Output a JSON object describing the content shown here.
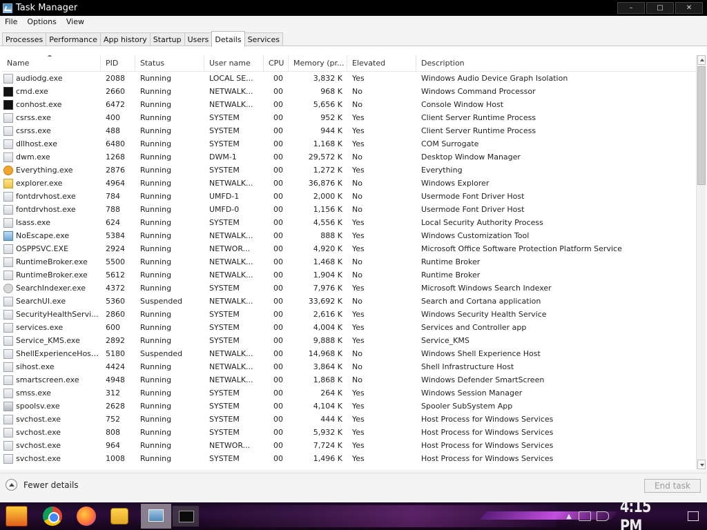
{
  "window": {
    "title": "Task Manager",
    "controls": [
      "–",
      "□",
      "✕"
    ]
  },
  "menu": [
    "File",
    "Options",
    "View"
  ],
  "tabs": [
    {
      "label": "Processes",
      "active": false
    },
    {
      "label": "Performance",
      "active": false
    },
    {
      "label": "App history",
      "active": false
    },
    {
      "label": "Startup",
      "active": false
    },
    {
      "label": "Users",
      "active": false
    },
    {
      "label": "Details",
      "active": true
    },
    {
      "label": "Services",
      "active": false
    }
  ],
  "columns": [
    "Name",
    "PID",
    "Status",
    "User name",
    "CPU",
    "Memory (pr...",
    "Elevated",
    "Description"
  ],
  "sort_column": "Name",
  "rows": [
    {
      "icon": "audio-icon",
      "name": "audiodg.exe",
      "pid": "2088",
      "status": "Running",
      "user": "LOCAL SE...",
      "cpu": "00",
      "mem": "3,832 K",
      "elevated": "Yes",
      "desc": "Windows Audio Device Graph Isolation"
    },
    {
      "icon": "cmd-icon",
      "name": "cmd.exe",
      "pid": "2660",
      "status": "Running",
      "user": "NETWALK...",
      "cpu": "00",
      "mem": "968 K",
      "elevated": "No",
      "desc": "Windows Command Processor"
    },
    {
      "icon": "cmd-icon",
      "name": "conhost.exe",
      "pid": "6472",
      "status": "Running",
      "user": "NETWALK...",
      "cpu": "00",
      "mem": "5,656 K",
      "elevated": "No",
      "desc": "Console Window Host"
    },
    {
      "icon": "process-icon",
      "name": "csrss.exe",
      "pid": "400",
      "status": "Running",
      "user": "SYSTEM",
      "cpu": "00",
      "mem": "952 K",
      "elevated": "Yes",
      "desc": "Client Server Runtime Process"
    },
    {
      "icon": "process-icon",
      "name": "csrss.exe",
      "pid": "488",
      "status": "Running",
      "user": "SYSTEM",
      "cpu": "00",
      "mem": "944 K",
      "elevated": "Yes",
      "desc": "Client Server Runtime Process"
    },
    {
      "icon": "process-icon",
      "name": "dllhost.exe",
      "pid": "6480",
      "status": "Running",
      "user": "SYSTEM",
      "cpu": "00",
      "mem": "1,168 K",
      "elevated": "Yes",
      "desc": "COM Surrogate"
    },
    {
      "icon": "process-icon",
      "name": "dwm.exe",
      "pid": "1268",
      "status": "Running",
      "user": "DWM-1",
      "cpu": "00",
      "mem": "29,572 K",
      "elevated": "No",
      "desc": "Desktop Window Manager"
    },
    {
      "icon": "search-icon",
      "name": "Everything.exe",
      "pid": "2876",
      "status": "Running",
      "user": "SYSTEM",
      "cpu": "00",
      "mem": "1,272 K",
      "elevated": "Yes",
      "desc": "Everything"
    },
    {
      "icon": "folder-icon",
      "name": "explorer.exe",
      "pid": "4964",
      "status": "Running",
      "user": "NETWALK...",
      "cpu": "00",
      "mem": "36,876 K",
      "elevated": "No",
      "desc": "Windows Explorer"
    },
    {
      "icon": "process-icon",
      "name": "fontdrvhost.exe",
      "pid": "784",
      "status": "Running",
      "user": "UMFD-1",
      "cpu": "00",
      "mem": "2,000 K",
      "elevated": "No",
      "desc": "Usermode Font Driver Host"
    },
    {
      "icon": "process-icon",
      "name": "fontdrvhost.exe",
      "pid": "788",
      "status": "Running",
      "user": "UMFD-0",
      "cpu": "00",
      "mem": "1,156 K",
      "elevated": "No",
      "desc": "Usermode Font Driver Host"
    },
    {
      "icon": "process-icon",
      "name": "lsass.exe",
      "pid": "624",
      "status": "Running",
      "user": "SYSTEM",
      "cpu": "00",
      "mem": "4,556 K",
      "elevated": "Yes",
      "desc": "Local Security Authority Process"
    },
    {
      "icon": "monitor-icon",
      "name": "NoEscape.exe",
      "pid": "5384",
      "status": "Running",
      "user": "NETWALK...",
      "cpu": "00",
      "mem": "888 K",
      "elevated": "Yes",
      "desc": "Windows Customization Tool"
    },
    {
      "icon": "process-icon",
      "name": "OSPPSVC.EXE",
      "pid": "2924",
      "status": "Running",
      "user": "NETWOR...",
      "cpu": "00",
      "mem": "4,920 K",
      "elevated": "Yes",
      "desc": "Microsoft Office Software Protection Platform Service"
    },
    {
      "icon": "process-icon",
      "name": "RuntimeBroker.exe",
      "pid": "5500",
      "status": "Running",
      "user": "NETWALK...",
      "cpu": "00",
      "mem": "1,468 K",
      "elevated": "No",
      "desc": "Runtime Broker"
    },
    {
      "icon": "process-icon",
      "name": "RuntimeBroker.exe",
      "pid": "5612",
      "status": "Running",
      "user": "NETWALK...",
      "cpu": "00",
      "mem": "1,904 K",
      "elevated": "No",
      "desc": "Runtime Broker"
    },
    {
      "icon": "user-icon",
      "name": "SearchIndexer.exe",
      "pid": "4372",
      "status": "Running",
      "user": "SYSTEM",
      "cpu": "00",
      "mem": "7,976 K",
      "elevated": "Yes",
      "desc": "Microsoft Windows Search Indexer"
    },
    {
      "icon": "process-icon",
      "name": "SearchUI.exe",
      "pid": "5360",
      "status": "Suspended",
      "user": "NETWALK...",
      "cpu": "00",
      "mem": "33,692 K",
      "elevated": "No",
      "desc": "Search and Cortana application"
    },
    {
      "icon": "process-icon",
      "name": "SecurityHealthServi...",
      "pid": "2860",
      "status": "Running",
      "user": "SYSTEM",
      "cpu": "00",
      "mem": "2,616 K",
      "elevated": "Yes",
      "desc": "Windows Security Health Service"
    },
    {
      "icon": "process-icon",
      "name": "services.exe",
      "pid": "600",
      "status": "Running",
      "user": "SYSTEM",
      "cpu": "00",
      "mem": "4,004 K",
      "elevated": "Yes",
      "desc": "Services and Controller app"
    },
    {
      "icon": "process-icon",
      "name": "Service_KMS.exe",
      "pid": "2892",
      "status": "Running",
      "user": "SYSTEM",
      "cpu": "00",
      "mem": "9,888 K",
      "elevated": "Yes",
      "desc": "Service_KMS"
    },
    {
      "icon": "process-icon",
      "name": "ShellExperienceHost...",
      "pid": "5180",
      "status": "Suspended",
      "user": "NETWALK...",
      "cpu": "00",
      "mem": "14,968 K",
      "elevated": "No",
      "desc": "Windows Shell Experience Host"
    },
    {
      "icon": "process-icon",
      "name": "sihost.exe",
      "pid": "4424",
      "status": "Running",
      "user": "NETWALK...",
      "cpu": "00",
      "mem": "3,864 K",
      "elevated": "No",
      "desc": "Shell Infrastructure Host"
    },
    {
      "icon": "process-icon",
      "name": "smartscreen.exe",
      "pid": "4948",
      "status": "Running",
      "user": "NETWALK...",
      "cpu": "00",
      "mem": "1,868 K",
      "elevated": "No",
      "desc": "Windows Defender SmartScreen"
    },
    {
      "icon": "process-icon",
      "name": "smss.exe",
      "pid": "312",
      "status": "Running",
      "user": "SYSTEM",
      "cpu": "00",
      "mem": "264 K",
      "elevated": "Yes",
      "desc": "Windows Session Manager"
    },
    {
      "icon": "printer-icon",
      "name": "spoolsv.exe",
      "pid": "2628",
      "status": "Running",
      "user": "SYSTEM",
      "cpu": "00",
      "mem": "4,104 K",
      "elevated": "Yes",
      "desc": "Spooler SubSystem App"
    },
    {
      "icon": "process-icon",
      "name": "svchost.exe",
      "pid": "752",
      "status": "Running",
      "user": "SYSTEM",
      "cpu": "00",
      "mem": "444 K",
      "elevated": "Yes",
      "desc": "Host Process for Windows Services"
    },
    {
      "icon": "process-icon",
      "name": "svchost.exe",
      "pid": "808",
      "status": "Running",
      "user": "SYSTEM",
      "cpu": "00",
      "mem": "5,932 K",
      "elevated": "Yes",
      "desc": "Host Process for Windows Services"
    },
    {
      "icon": "process-icon",
      "name": "svchost.exe",
      "pid": "964",
      "status": "Running",
      "user": "NETWOR...",
      "cpu": "00",
      "mem": "7,724 K",
      "elevated": "Yes",
      "desc": "Host Process for Windows Services"
    },
    {
      "icon": "process-icon",
      "name": "svchost.exe",
      "pid": "1008",
      "status": "Running",
      "user": "SYSTEM",
      "cpu": "00",
      "mem": "1,496 K",
      "elevated": "Yes",
      "desc": "Host Process for Windows Services"
    }
  ],
  "footer": {
    "fewer_details": "Fewer details",
    "end_task": "End task"
  },
  "taskbar": {
    "clock": "4:15 PM",
    "apps": [
      "chrome-icon",
      "firefox-icon",
      "file-explorer-icon",
      "task-manager-icon",
      "command-prompt-icon"
    ]
  }
}
